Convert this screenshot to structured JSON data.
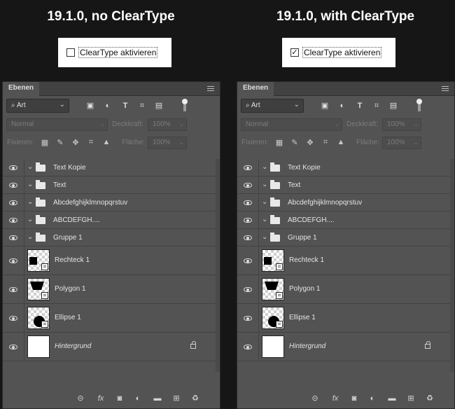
{
  "left": {
    "heading": "19.1.0, no ClearType",
    "cleartype_label": "ClearType aktivieren",
    "cleartype_checked": false,
    "checkbox_mark": ""
  },
  "right": {
    "heading": "19.1.0, with ClearType",
    "cleartype_label": "ClearType aktivieren",
    "cleartype_checked": true,
    "checkbox_mark": "✓"
  },
  "panel": {
    "tab_label": "Ebenen",
    "filter_kind": "Art",
    "blend_mode": "Normal",
    "opacity_label": "Deckkraft:",
    "opacity_value": "100%",
    "lock_label": "Fixieren:",
    "fill_label": "Fläche:",
    "fill_value": "100%"
  },
  "layers": [
    {
      "name": "Text Kopie",
      "kind": "group"
    },
    {
      "name": "Text",
      "kind": "group"
    },
    {
      "name": "Abcdefghijklmnopqrstuv",
      "kind": "group"
    },
    {
      "name": "ABCDEFGH....",
      "kind": "group"
    },
    {
      "name": "Gruppe 1",
      "kind": "group"
    },
    {
      "name": "Rechteck 1",
      "kind": "shape",
      "shape": "rectangle"
    },
    {
      "name": "Polygon 1",
      "kind": "shape",
      "shape": "polygon"
    },
    {
      "name": "Ellipse 1",
      "kind": "shape",
      "shape": "ellipse"
    },
    {
      "name": "Hintergrund",
      "kind": "background",
      "locked": true
    }
  ],
  "icons": {
    "filter": "search-icon",
    "layer_filters": [
      "image-filter-icon",
      "adjustment-filter-icon",
      "type-filter-icon",
      "shape-filter-icon",
      "smart-object-filter-icon"
    ],
    "lock_options": [
      "lock-transparent-icon",
      "lock-pixels-icon",
      "lock-position-icon",
      "lock-artboard-icon",
      "lock-all-icon"
    ],
    "footer": [
      "link-icon",
      "fx-icon",
      "mask-icon",
      "adjustment-layer-icon",
      "new-group-icon",
      "new-layer-icon",
      "delete-icon"
    ]
  },
  "colors": {
    "background": "#161616",
    "panel": "#535353",
    "panel_header": "#424242",
    "text": "#e4e4e4"
  }
}
